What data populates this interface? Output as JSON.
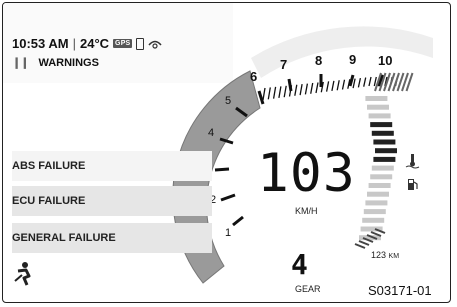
{
  "status": {
    "time": "10:53 AM",
    "separator": "|",
    "temperature": "24°C",
    "gps_label": "GPS",
    "icons": [
      "gps-icon",
      "phone-icon",
      "connectivity-icon"
    ]
  },
  "warnings": {
    "label": "WARNINGS",
    "icon": "pause-icon",
    "items": [
      {
        "label": "ABS FAILURE",
        "selected": true
      },
      {
        "label": "ECU FAILURE",
        "selected": false
      },
      {
        "label": "GENERAL FAILURE",
        "selected": false
      }
    ],
    "bottom_icon": "rider-seat-icon"
  },
  "tachometer": {
    "tick_labels": [
      "1",
      "2",
      "3",
      "4",
      "5",
      "6",
      "7",
      "8",
      "9",
      "10"
    ]
  },
  "speed": {
    "value": "103",
    "unit": "KM/H"
  },
  "gear": {
    "value": "4",
    "label": "GEAR"
  },
  "range": {
    "value": "123",
    "unit": "KM"
  },
  "indicators": [
    "coolant-temp-icon",
    "fuel-pump-icon"
  ],
  "figure_code": "S03171-01",
  "colors": {
    "sector": "#9a9a9a",
    "row_selected": "#f4f4f4",
    "row_other": "#e6e6e6",
    "text": "#111111"
  }
}
